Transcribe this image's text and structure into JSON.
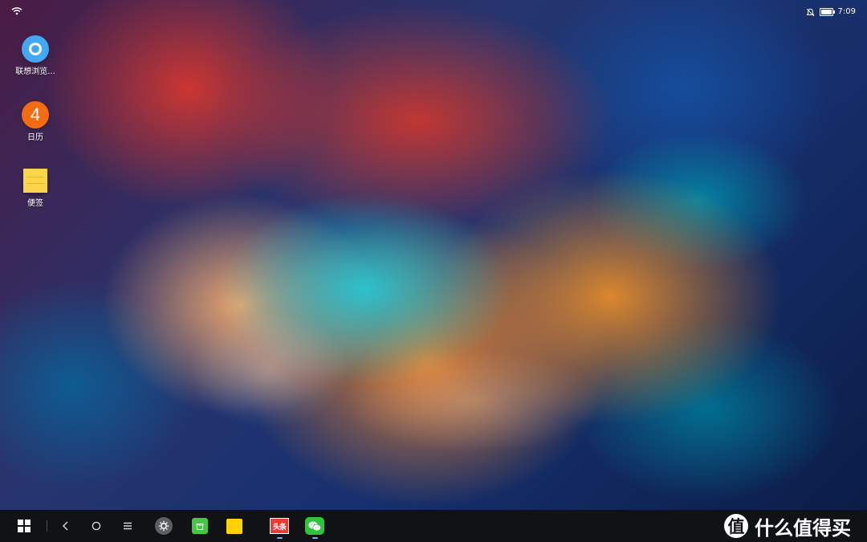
{
  "wallpaper": {
    "colors": {
      "orange": "#eb842d",
      "red": "#d7372a",
      "teal": "#28c8d2",
      "navy": "#122a63"
    }
  },
  "status_bar": {
    "time": "7:09",
    "icons": [
      "wifi-icon",
      "notification-off-icon",
      "battery-icon"
    ]
  },
  "desktop": {
    "items": [
      {
        "label": "联想浏览...",
        "icon": "browser-icon"
      },
      {
        "label": "日历",
        "icon": "calendar-icon",
        "badge": "4"
      },
      {
        "label": "便签",
        "icon": "notes-icon"
      }
    ]
  },
  "taskbar": {
    "buttons": [
      {
        "name": "start-menu",
        "icon": "windows-grid-icon"
      },
      {
        "name": "back",
        "icon": "back-arrow-icon"
      },
      {
        "name": "home",
        "icon": "home-circle-icon"
      },
      {
        "name": "menu",
        "icon": "hamburger-menu-icon"
      }
    ],
    "apps": [
      {
        "name": "settings",
        "icon": "gear-icon"
      },
      {
        "name": "app-store",
        "icon": "shopping-bag-icon"
      },
      {
        "name": "file-manager",
        "icon": "folder-icon"
      },
      {
        "name": "toutiao",
        "icon": "toutiao-icon",
        "label": "头条"
      },
      {
        "name": "wechat",
        "icon": "wechat-icon"
      }
    ],
    "watermark": {
      "mark": "值",
      "text": "什么值得买"
    }
  }
}
